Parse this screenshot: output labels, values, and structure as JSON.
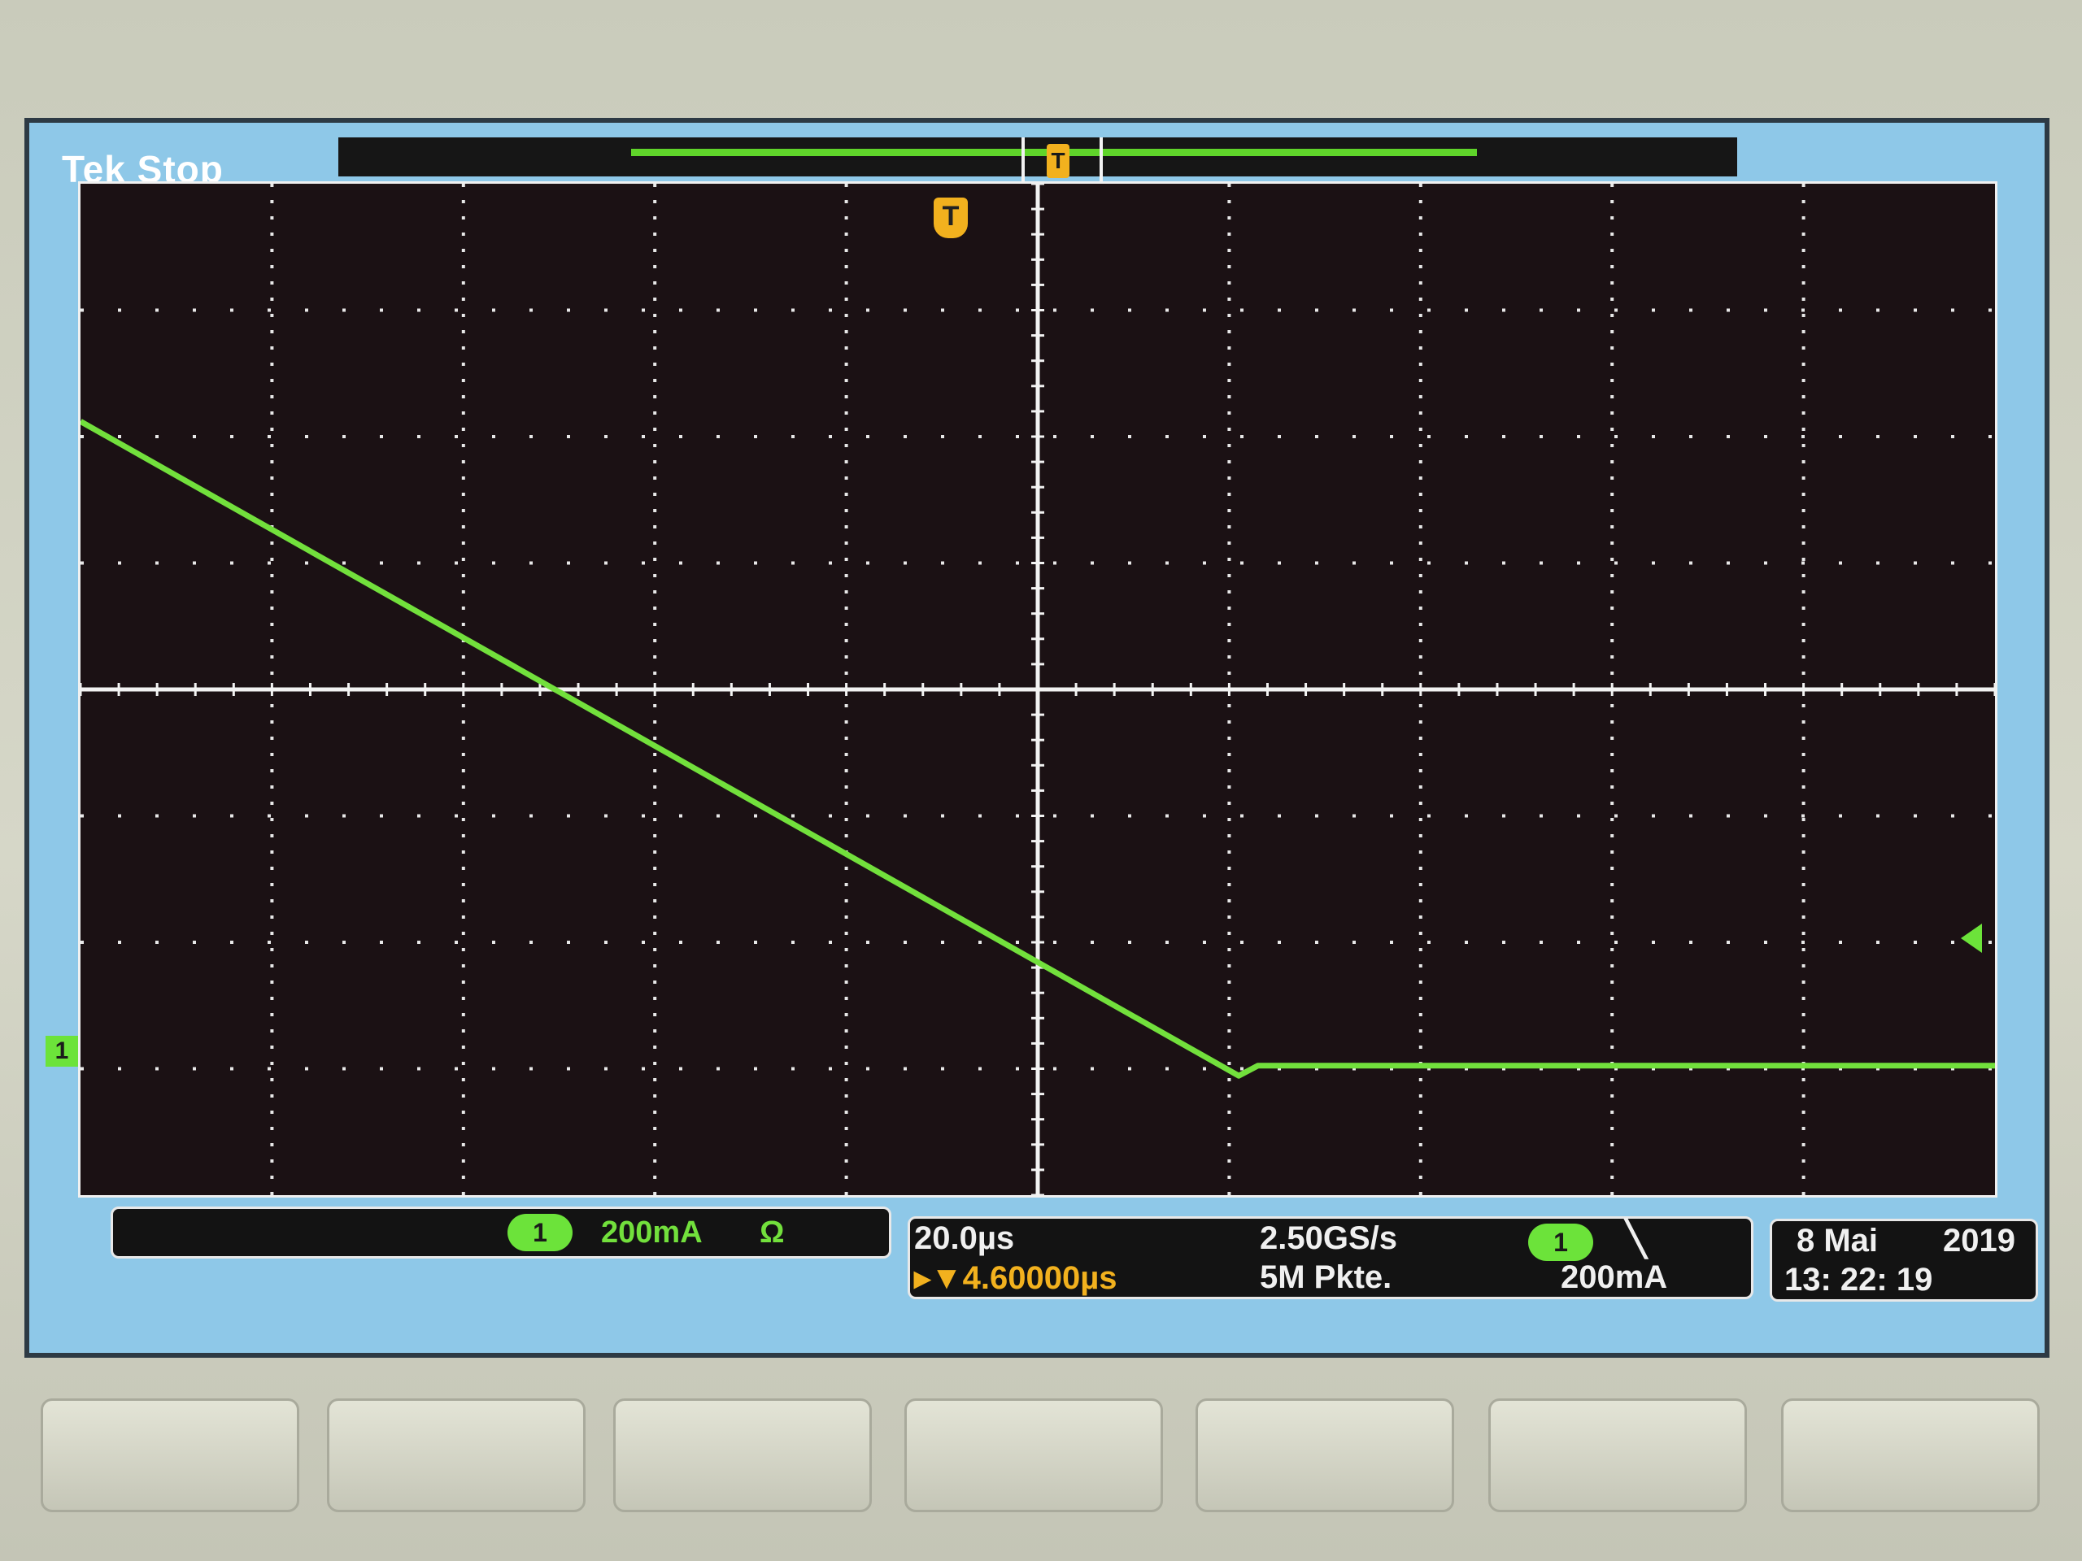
{
  "header": {
    "brand": "Tek Stop"
  },
  "markers": {
    "trigger_position_icon": "trigger-position-marker-icon",
    "trigger_symbol": "T",
    "channel_symbol": "1"
  },
  "channel": {
    "number": "1",
    "scale": "200mA",
    "coupling_icon": "Ω"
  },
  "timebase": {
    "scale": "20.0µs",
    "trigger_position": "▸▼4.60000µs",
    "sample_rate": "2.50GS/s",
    "record_length": "5M Pkte."
  },
  "trigger": {
    "source": "1",
    "slope_icon": "falling-edge-icon",
    "slope_symbol": "╲",
    "level": "200mA"
  },
  "clock": {
    "date_day_month": "8 Mai",
    "year": "2019",
    "time": "13: 22: 19"
  },
  "colors": {
    "trace": "#72e03c",
    "trigger": "#f2b11e",
    "screen_bg": "#1b1114"
  },
  "softkeys": [
    "",
    "",
    "",
    "",
    "",
    "",
    ""
  ]
}
